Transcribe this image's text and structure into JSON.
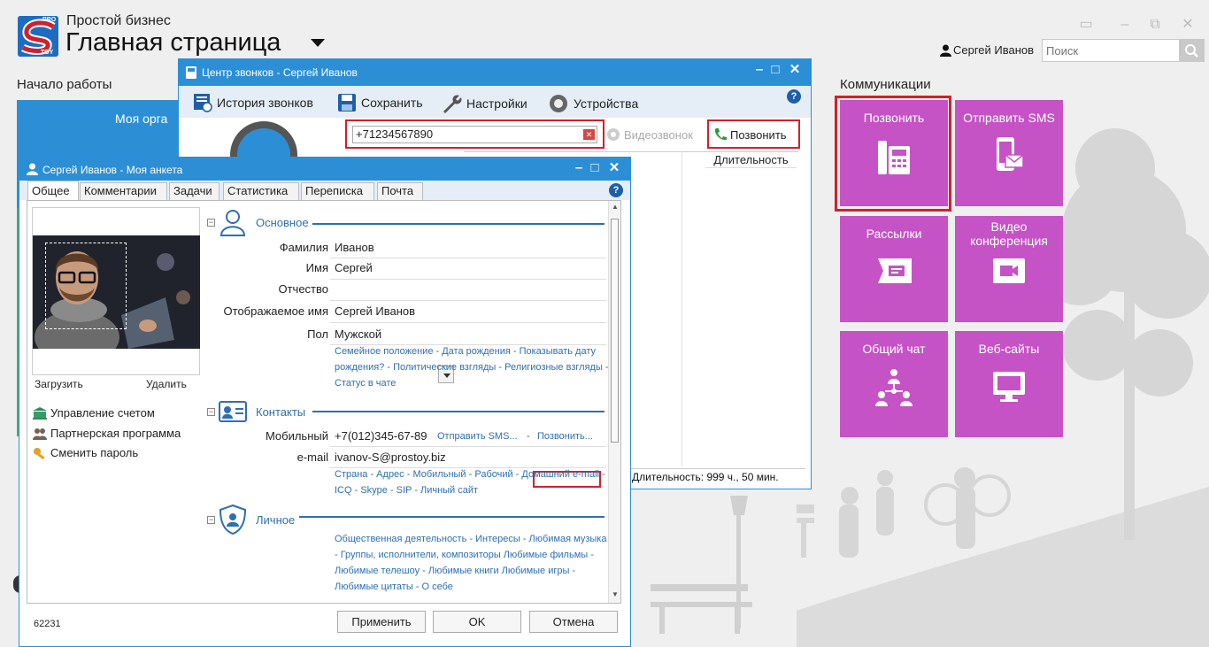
{
  "app": {
    "subtitle": "Простой бизнес",
    "title": "Главная страница",
    "logo_text_top": "PRO",
    "logo_text_bottom": "TOY"
  },
  "header": {
    "user_name": "Сергей Иванов",
    "search_placeholder": "Поиск"
  },
  "sections": {
    "start": "Начало работы",
    "communications": "Коммуникации",
    "start_tile": "Моя орга"
  },
  "tiles": [
    {
      "label": "Позвонить",
      "icon": "desk-phone-icon"
    },
    {
      "label": "Отправить SMS",
      "icon": "mobile-sms-icon"
    },
    {
      "label": "Рассылки",
      "icon": "mailing-icon"
    },
    {
      "label": "Видео конференция",
      "icon": "video-camera-icon"
    },
    {
      "label": "Общий чат",
      "icon": "group-chat-icon"
    },
    {
      "label": "Веб-сайты",
      "icon": "monitor-icon"
    }
  ],
  "colors": {
    "tile": "#c553c5",
    "titlebar": "#2c8fd6",
    "highlight": "#d2202a",
    "link": "#2f6fb0"
  },
  "callcenter": {
    "title": "Центр звонков - Сергей Иванов",
    "toolbar": [
      "История звонков",
      "Сохранить",
      "Настройки",
      "Устройства"
    ],
    "phone_value": "+71234567890",
    "video_label": "Видеозвонок",
    "call_label": "Позвонить",
    "column_duration": "Длительность",
    "status": "Длительность: 999 ч., 50 мин."
  },
  "profile": {
    "title": "Сергей Иванов - Моя анкета",
    "tabs": [
      "Общее",
      "Комментарии",
      "Задачи",
      "Статистика",
      "Переписка",
      "Почта"
    ],
    "photo_upload": "Загрузить",
    "photo_delete": "Удалить",
    "side_links": [
      "Управление счетом",
      "Партнерская программа",
      "Сменить пароль"
    ],
    "basic": {
      "title": "Основное",
      "fields": [
        {
          "label": "Фамилия",
          "value": "Иванов"
        },
        {
          "label": "Имя",
          "value": "Сергей"
        },
        {
          "label": "Отчество",
          "value": ""
        },
        {
          "label": "Отображаемое имя",
          "value": "Сергей Иванов"
        },
        {
          "label": "Пол",
          "value": "Мужской"
        }
      ],
      "more_links": "Семейное положение -  Дата рождения -  Показывать дату рождения? -  Политические взгляды -  Религиозные взгляды -  Статус в чате"
    },
    "contacts": {
      "title": "Контакты",
      "mobile_label": "Мобильный",
      "mobile_value": "+7(012)345-67-89",
      "send_sms": "Отправить SMS...",
      "call": "Позвонить...",
      "email_label": "e-mail",
      "email_value": "ivanov-S@prostoy.biz",
      "more_links": "Страна -  Адрес -  Мобильный -  Рабочий -  Домашний e-mail -  ICQ -  Skype -  SIP -  Личный сайт"
    },
    "personal": {
      "title": "Личное",
      "more_links": "Общественная деятельность -  Интересы -  Любимая музыка -  Группы, исполнители, композиторы Любимые фильмы -  Любимые телешоу -  Любимые книги Любимые игры -  Любимые цитаты -  О себе"
    },
    "footer_id": "62231",
    "buttons": {
      "apply": "Применить",
      "ok": "OK",
      "cancel": "Отмена"
    }
  }
}
